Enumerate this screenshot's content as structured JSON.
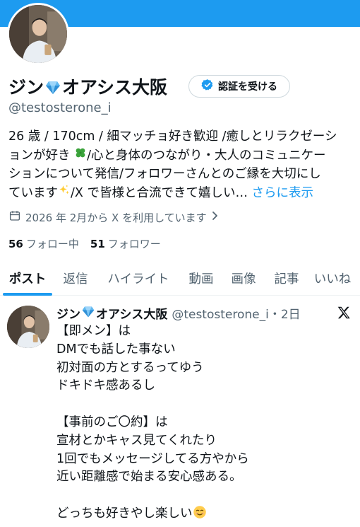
{
  "profile": {
    "display_name_part1": "ジン",
    "display_name_part2": "オアシス大阪",
    "name_emoji": "gem-emoji",
    "handle": "@testosterone_i",
    "verify_button": "認証を受ける",
    "bio_lines": [
      "26 歳 / 170cm / 細マッチョ好き歓迎 /癒しとリラクゼーシ",
      "ョンが好き",
      "/心と身体のつながり・大人のコミュニケー",
      "ションについて発信/フォロワーさんとのご縁を大切にし",
      "ています",
      "/X で皆様と合流できて嬉しい…",
      "さらに表示"
    ],
    "joined_text": "2026 年 2月から X を利用しています",
    "following_count": "56",
    "following_label": "フォロー中",
    "followers_count": "51",
    "followers_label": "フォロワー"
  },
  "tabs": [
    "ポスト",
    "返信",
    "ハイライト",
    "動画",
    "画像",
    "記事",
    "いいね"
  ],
  "active_tab": "ポスト",
  "post": {
    "name_part1": "ジン",
    "name_part2": "オアシス大阪",
    "handle_time": "@testosterone_i・2日",
    "lines": [
      "【即メン】は",
      "DMでも話した事ない",
      "初対面の方とするってゆう",
      "ドキドキ感あるし",
      "",
      "【事前のご〇約】は",
      "宣材とかキャス見てくれたり",
      "1回でもメッセージしてる方やから",
      "近い距離感で始まる安心感ある。",
      "",
      "どっちも好きやし楽しい"
    ],
    "last_emoji": "smiling-emoji"
  },
  "colors": {
    "accent": "#1d9bf0",
    "text_primary": "#0f1419",
    "text_secondary": "#536471",
    "border": "#cfd9de"
  },
  "icons": [
    "calendar-icon",
    "chevron-right-icon",
    "verified-badge-icon",
    "x-logo-icon",
    "clover-emoji",
    "sparkles-emoji"
  ]
}
